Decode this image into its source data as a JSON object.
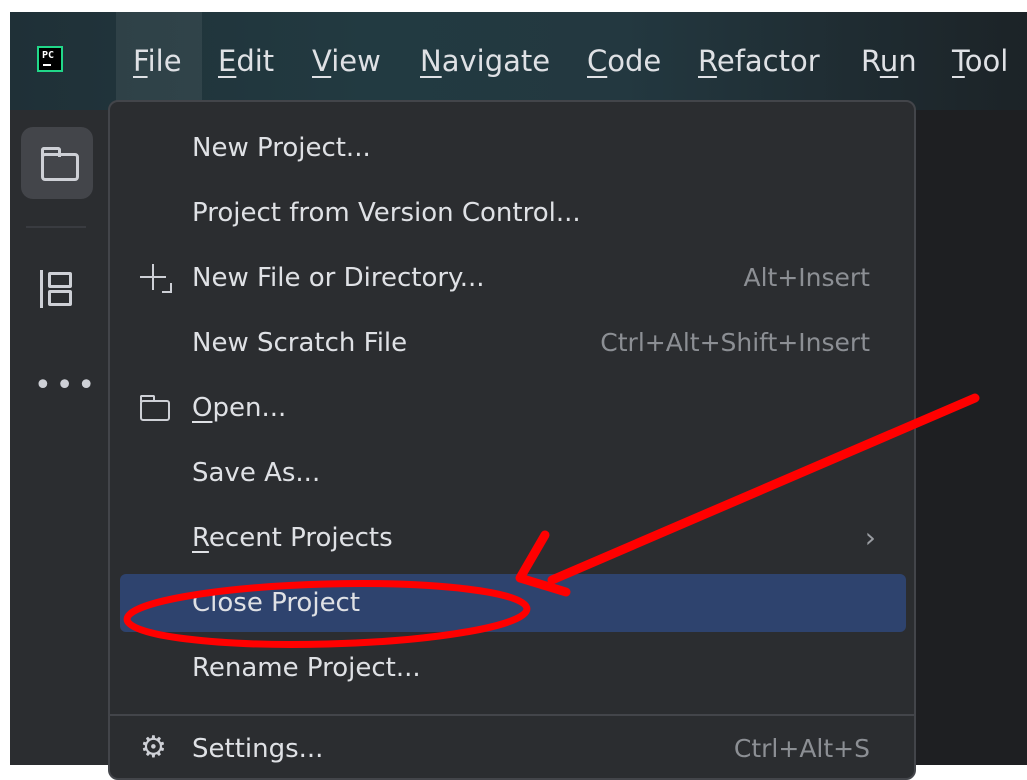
{
  "app": {
    "logo_text": "PC",
    "logo_border_color": "#21d789"
  },
  "menubar": {
    "items": [
      {
        "id": "file",
        "mnemonic": "F",
        "rest": "ile"
      },
      {
        "id": "edit",
        "mnemonic": "E",
        "rest": "dit"
      },
      {
        "id": "view",
        "mnemonic": "V",
        "rest": "iew"
      },
      {
        "id": "navigate",
        "mnemonic": "N",
        "rest": "avigate"
      },
      {
        "id": "code",
        "mnemonic": "C",
        "rest": "ode"
      },
      {
        "id": "refactor",
        "mnemonic": "R",
        "rest": "efactor"
      },
      {
        "id": "run",
        "before": "R",
        "mnemonic": "u",
        "rest": "n"
      },
      {
        "id": "tools",
        "mnemonic": "T",
        "rest": "ool"
      }
    ]
  },
  "toolstrip": {
    "icons": [
      "folder-icon",
      "structure-icon",
      "more-icon"
    ]
  },
  "file_menu": {
    "items": [
      {
        "label": "New Project..."
      },
      {
        "label": "Project from Version Control..."
      },
      {
        "label": "New File or Directory...",
        "shortcut": "Alt+Insert",
        "icon": "plus-icon"
      },
      {
        "label": "New Scratch File",
        "shortcut": "Ctrl+Alt+Shift+Insert"
      },
      {
        "mnemonic": "O",
        "rest": "pen...",
        "icon": "folder-icon"
      },
      {
        "label": "Save As..."
      },
      {
        "mnemonic": "R",
        "rest": "ecent Projects",
        "submenu": true,
        "submenu_glyph": "›"
      },
      {
        "label": "Close Project",
        "selected": true
      },
      {
        "label": "Rename Project..."
      },
      {
        "label": "Settings...",
        "shortcut": "Ctrl+Alt+S",
        "icon": "gear-icon",
        "gear_glyph": "⚙"
      }
    ]
  },
  "annotation": {
    "color": "#ff0000"
  }
}
